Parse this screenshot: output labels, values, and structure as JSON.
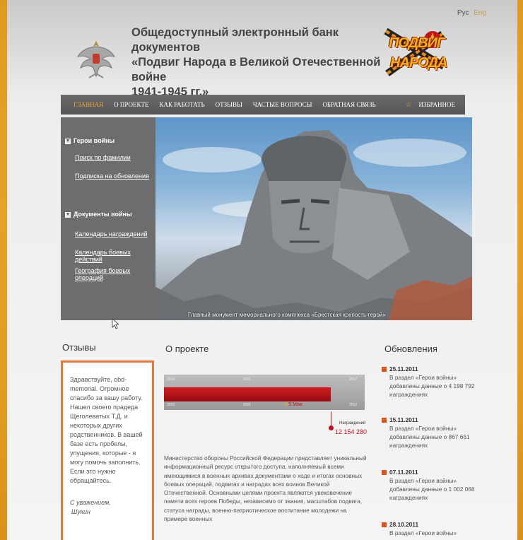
{
  "header": {
    "lang_ru": "Рус",
    "lang_en": "Eng",
    "title_line1": "Общедоступный электронный банк документов",
    "title_line2": "«Подвиг Народа в Великой Отечественной войне",
    "title_line3": "1941-1945 гг.»",
    "logo_line1": "ПОДВИГ",
    "logo_line2": "НАРОДА"
  },
  "nav": {
    "items": [
      "Главная",
      "О проекте",
      "Как работать",
      "Отзывы",
      "Частые вопросы",
      "Обратная связь"
    ],
    "favorites": "Избранное"
  },
  "sidebar": {
    "section1": "Герои войны",
    "link1": "Поиск по фамилии",
    "link2": "Подписка на обновления",
    "section2": "Документы войны",
    "link3": "Календарь награждений",
    "link4": "Календарь боевых действий",
    "link5": "География боевых операций"
  },
  "hero": {
    "caption": "Главный монумент мемориального комплекса «Брестская крепость-герой»"
  },
  "reviews": {
    "heading": "Отзывы",
    "text": "Здравствуйте, obd-memorial. Огромное спасибо за вашу работу. Нашел своего прадеда Щеголеватых Т.Д. и некоторых других родственников. В вашей базе есть пробелы, упущения, которые - я могу помочь заполнить. Если это нужно обращайтесь.",
    "sign1": "С уважением,",
    "sign2": "Шукин"
  },
  "about": {
    "heading": "О проекте",
    "timeline_years_top": [
      "2010",
      "2011",
      "2012"
    ],
    "timeline_years_bottom": [
      "2010",
      "2011",
      "2012"
    ],
    "timeline_marker": "9 Мая",
    "awards_label": "Награждений",
    "awards_count": "12 154 280",
    "text": "Министерство обороны Российской Федерации представляет уникальный информационный ресурс открытого доступа, наполняемый всеми имеющимися в военных архивах документами о ходе и итогах основных боевых операций, подвигах и наградах всех воинов Великой Отечественной. Основными целями проекта являются увековечение памяти всех героев Победы, независимо от звания, масштабов подвига, статуса награды, военно-патриотическое воспитание молодежи на примере военных"
  },
  "updates": {
    "heading": "Обновления",
    "items": [
      {
        "date": "25.11.2011",
        "text": "В раздел «Герои войны» добавлены данные о 4 198 792 награждениях"
      },
      {
        "date": "15.11.2011",
        "text": "В раздел «Герои войны» добавлены данные о 867 661 награждениях"
      },
      {
        "date": "07.11.2011",
        "text": "В раздел «Герои войны» добавлены данные о 1 002 068 награждениях"
      },
      {
        "date": "28.10.2011",
        "text": "В раздел «Герои войны»"
      }
    ]
  },
  "colors": {
    "accent_orange": "#e6a23a",
    "nav_bg": "#5c5c5c",
    "sidebar_bg": "#6d6d6d",
    "timeline_red": "#c0141a",
    "review_border": "#e07a3a"
  }
}
